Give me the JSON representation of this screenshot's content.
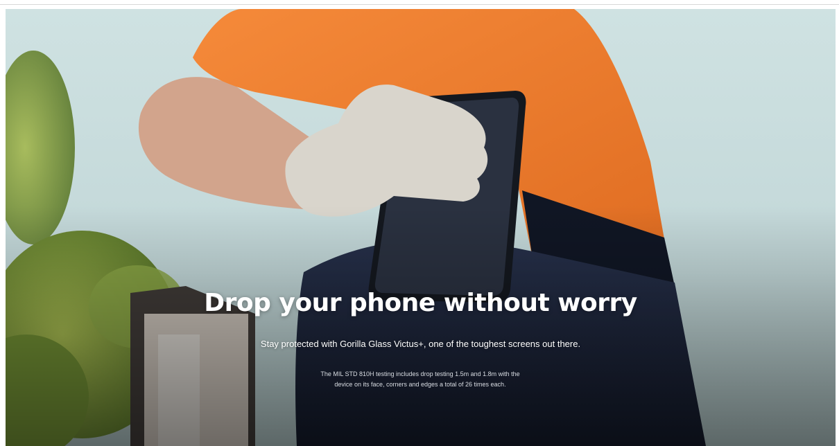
{
  "hero": {
    "headline": "Drop your phone without worry",
    "subhead": "Stay protected with Gorilla Glass Victus+, one of the toughest screens out there.",
    "footnote": "The MIL STD 810H testing includes drop testing 1.5m and 1.8m with the device on its face, corners and edges a total of 26 times each.",
    "image_subject": "worker in orange shirt and glove holding a rugged phone at the hip"
  },
  "colors": {
    "sky": "#c7dcdd",
    "shirt": "#f07a2a",
    "pants": "#1b2236",
    "glove": "#d7d3c9",
    "phone": "#1e232b",
    "foliage": "#7f9a3a"
  }
}
